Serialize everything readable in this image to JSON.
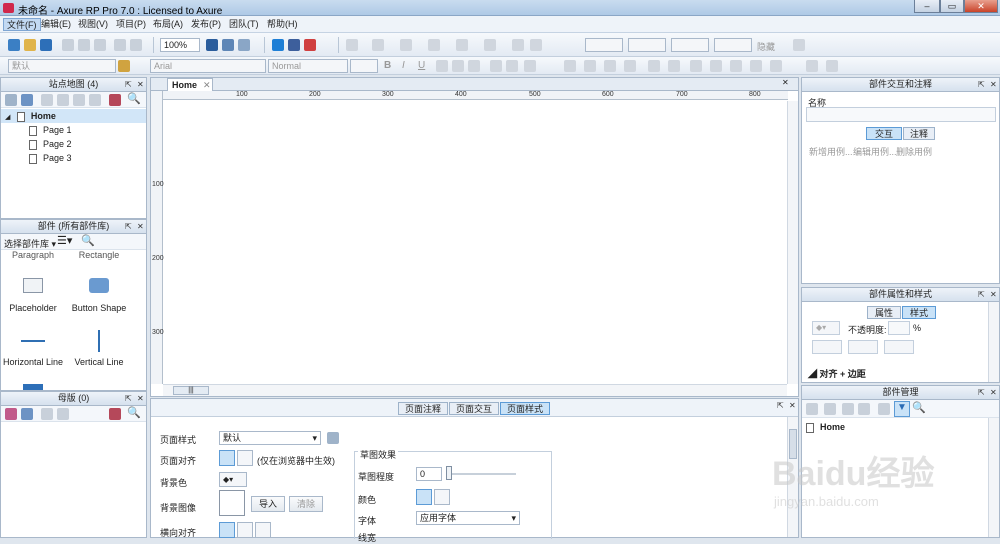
{
  "window": {
    "title": "未命名 - Axure RP Pro 7.0 : Licensed to Axure"
  },
  "menu": [
    "文件(F)",
    "编辑(E)",
    "视图(V)",
    "项目(P)",
    "布局(A)",
    "发布(P)",
    "团队(T)",
    "帮助(H)"
  ],
  "toolbar": {
    "zoom": "100%",
    "font": "默认",
    "font_family": "Arial",
    "style": "Normal",
    "hidden_label": "隐藏"
  },
  "sitemap": {
    "title": "站点地图 (4)",
    "pages": [
      "Home",
      "Page 1",
      "Page 2",
      "Page 3"
    ]
  },
  "widgets": {
    "title": "部件 (所有部件库)",
    "selector": "选择部件库",
    "row0": [
      "Paragraph",
      "Rectangle"
    ],
    "items": [
      "Placeholder",
      "Button Shape",
      "Horizontal Line",
      "Vertical Line"
    ]
  },
  "masters": {
    "title": "母版 (0)"
  },
  "canvas": {
    "tab": "Home",
    "ruler_x": [
      "100",
      "200",
      "300",
      "400",
      "500",
      "600",
      "700",
      "800"
    ],
    "ruler_y": [
      "100",
      "200",
      "300"
    ],
    "hscroll": "|||"
  },
  "props": {
    "tabs": [
      "页面注释",
      "页面交互",
      "页面样式"
    ],
    "page_style_label": "页面样式",
    "page_style_value": "默认",
    "align_label": "页面对齐",
    "align_note": "(仅在浏览器中生效)",
    "bg_color_label": "背景色",
    "bg_image_label": "背景图像",
    "import_btn": "导入",
    "clear_btn": "清除",
    "repeat_label": "横向对齐",
    "sketch": {
      "title": "草图效果",
      "degree_label": "草图程度",
      "degree_value": "0",
      "color_label": "颜色",
      "font_label": "字体",
      "font_value": "应用字体",
      "line_label": "线宽"
    }
  },
  "interactions": {
    "title": "部件交互和注释",
    "name_label": "名称",
    "tabs": [
      "交互",
      "注释"
    ],
    "actions": [
      "新增用例...",
      "编辑用例...",
      "删除用例"
    ]
  },
  "widget_props": {
    "title": "部件属性和样式",
    "tabs": [
      "属性",
      "样式"
    ],
    "opacity_label": "不透明度:",
    "opacity_unit": "%",
    "section": "对齐 + 边距"
  },
  "widget_manager": {
    "title": "部件管理",
    "items": [
      "Home"
    ]
  },
  "watermark": {
    "brand": "Baidu经验",
    "url": "jingyan.baidu.com"
  },
  "colors": {
    "accent": "#4a90d9",
    "titlebar": "#aec9e6"
  }
}
